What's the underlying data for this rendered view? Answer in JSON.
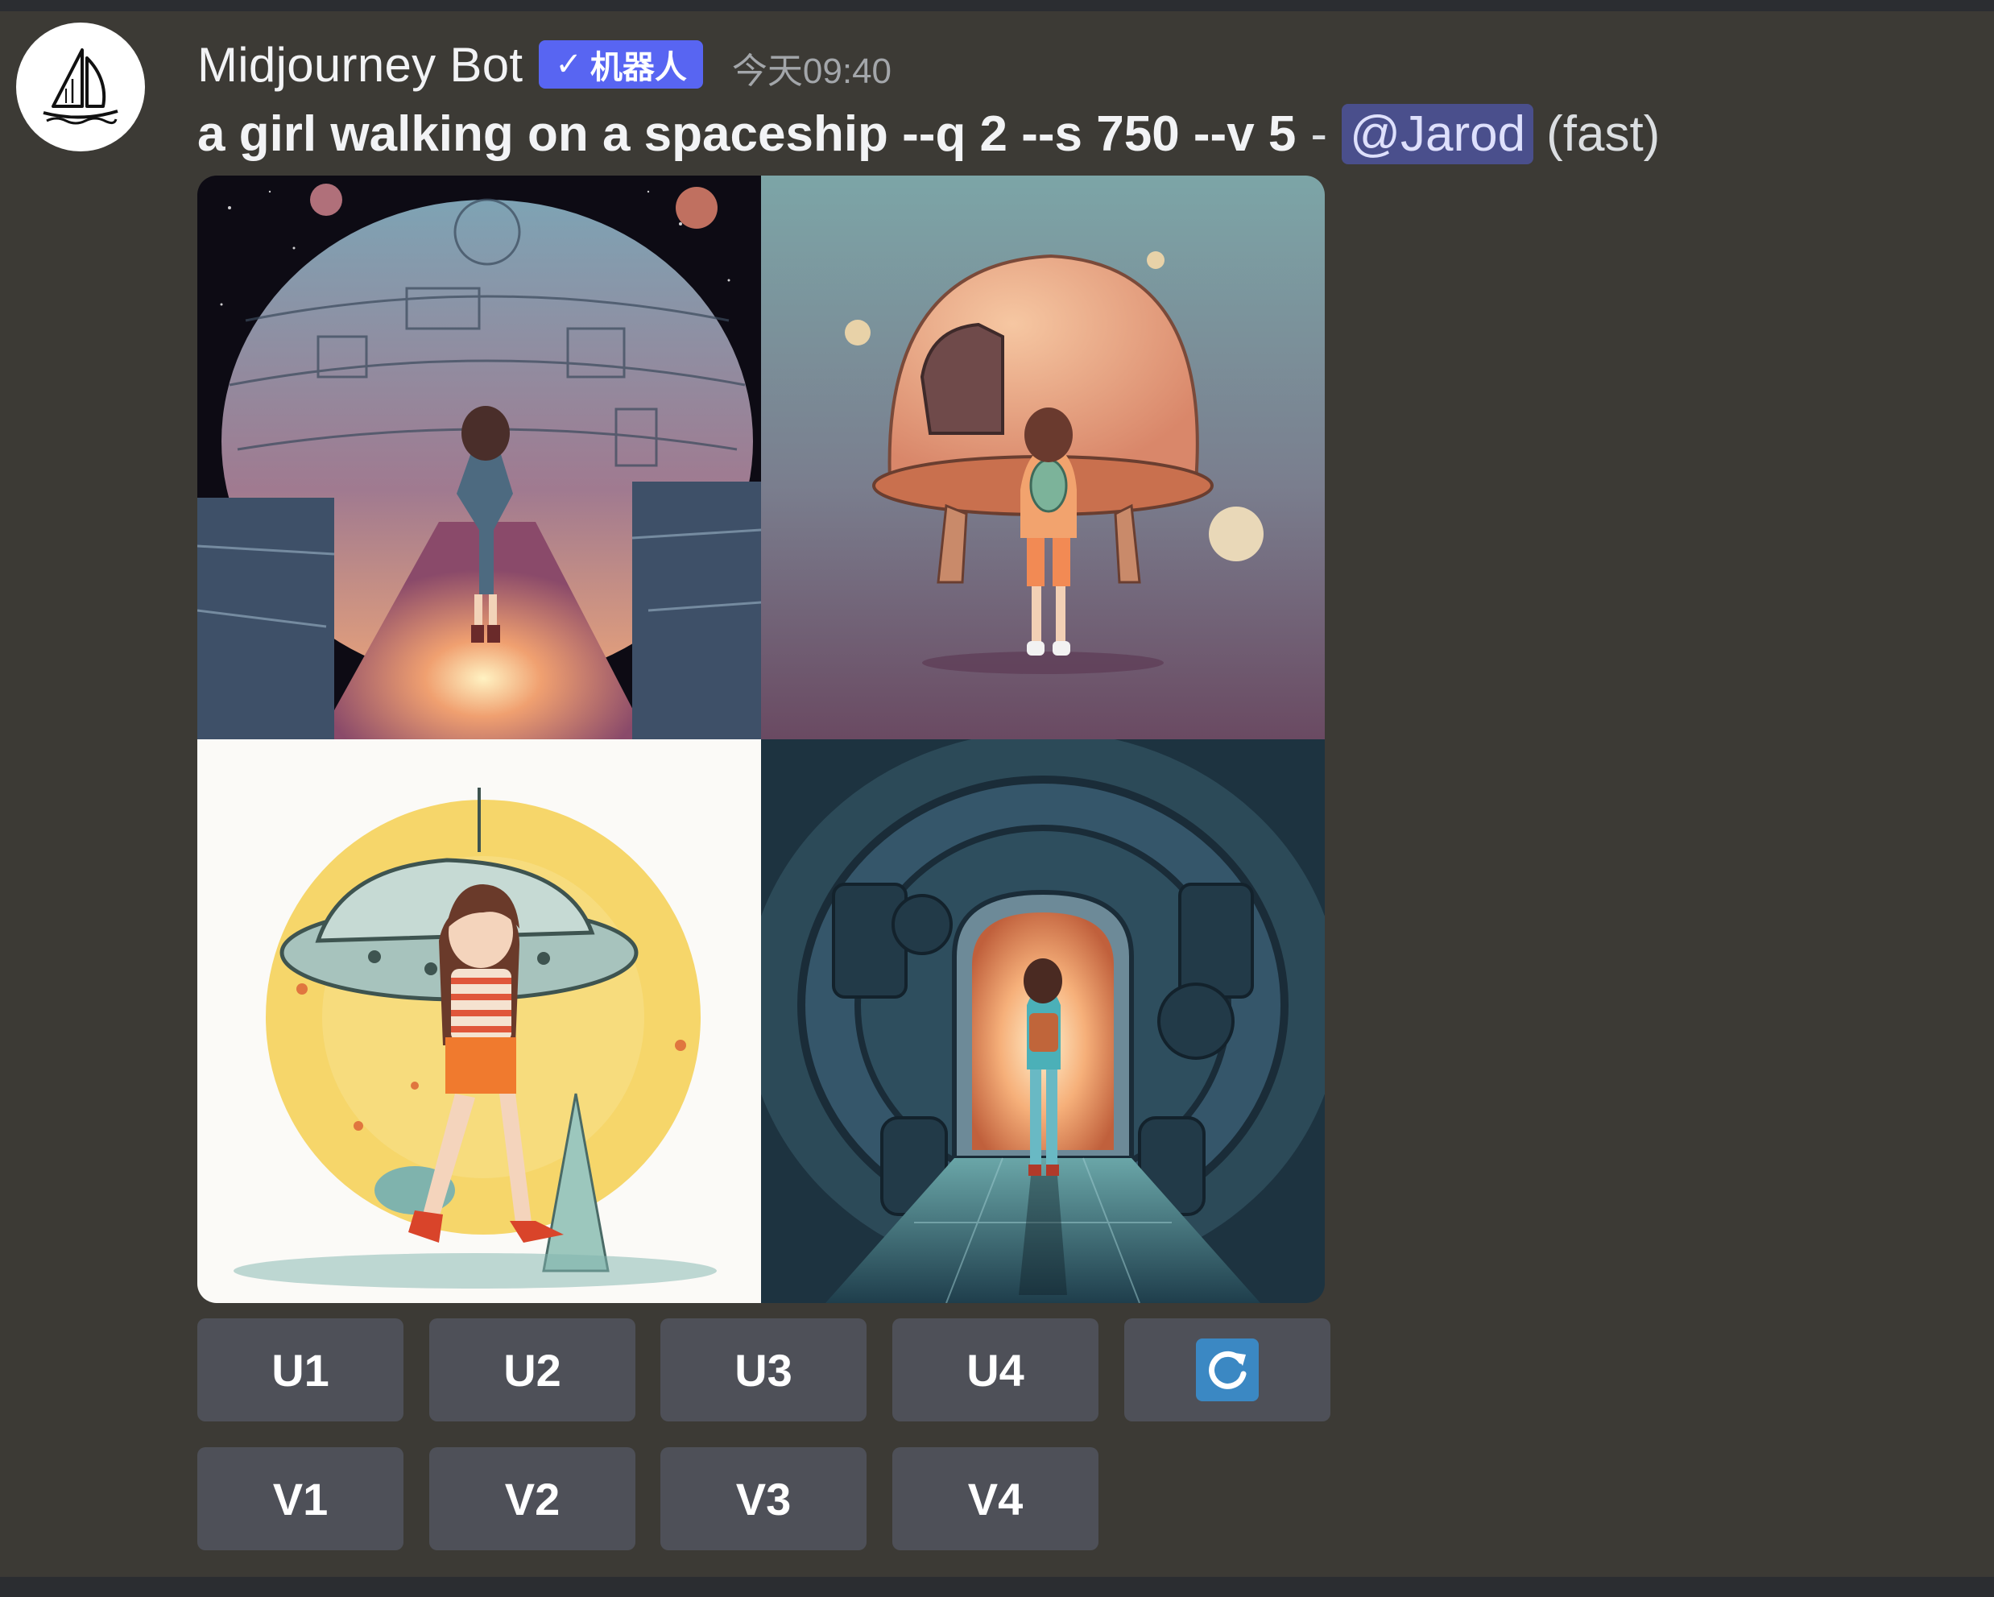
{
  "message": {
    "author": "Midjourney Bot",
    "bot_badge": "机器人",
    "timestamp": "今天09:40",
    "prompt": "a girl walking on a spaceship --q 2 --s 750 --v 5",
    "separator": "-",
    "mention": "@Jarod",
    "speed": "(fast)"
  },
  "images": [
    {
      "icon": "spaceship-planet-girl-image"
    },
    {
      "icon": "pod-girl-image"
    },
    {
      "icon": "flying-saucer-girl-image"
    },
    {
      "icon": "tunnel-girl-image"
    }
  ],
  "buttons": {
    "upscale": [
      "U1",
      "U2",
      "U3",
      "U4"
    ],
    "variation": [
      "V1",
      "V2",
      "V3",
      "V4"
    ],
    "reroll_icon": "refresh-icon"
  },
  "colors": {
    "brand": "#5865f2",
    "mention_bg": "#4a4f8c",
    "button_bg": "#4e5058",
    "reroll": "#3b88c3"
  }
}
